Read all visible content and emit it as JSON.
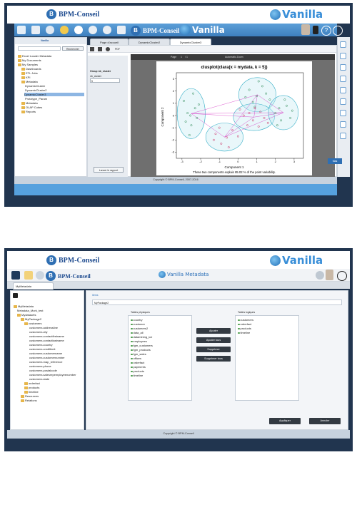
{
  "top": {
    "brand": "BPM-Conseil",
    "vanilla": "Vanilla",
    "toolbar_brand": "BPM-Conseil",
    "toolbar_vanilla": "Vanilla",
    "tree_title": "Vanilla",
    "search_button": "Rechercher",
    "tree": [
      "Excel Loader Metadata",
      "My Documents",
      "My Samples",
      "Dashboards",
      "ETL Jobs",
      "KPI",
      "Metadata",
      "DynamicCluster",
      "DynamicCluster2",
      "DynamicCluster3",
      "Prototype_Param",
      "Metadata",
      "OLAP Cubes",
      "Reports"
    ],
    "tabs": [
      "Page d'accueil",
      "DynamicCluster2",
      "DynamicCluster3"
    ],
    "viewer": {
      "pdf_label": "PDF",
      "page_label": "Page",
      "page_value": "1",
      "of_label": "/ 1",
      "zoom_label": "Automatic Zoom"
    },
    "params": {
      "group_label": "Group nb_cluster",
      "field_label": "nb_cluster",
      "field_value": "5"
    },
    "launch_button": "Lancer le rapport",
    "plot_footer": "Component 1",
    "plot_caption": "These two components explain 85.02 % of the point variability.",
    "footer": "Copyright © BPM-Conseil, 2007-2016",
    "side_button": "Mas"
  },
  "bottom": {
    "brand": "BPM-Conseil",
    "vanilla": "Vanilla",
    "toolbar_brand": "BPM-Conseil",
    "metadata_title": "Vanilla Metadata",
    "tab": "MyMetadata",
    "breadcrumb": "Items",
    "name_value": "MyPackage2",
    "tree": [
      "MyMetadata",
      "Metadata_Mork_test",
      "Mydatasets",
      "MyPackage2",
      "customers",
      "customers.addressline",
      "customers.city",
      "customers.contactfirstname",
      "customers.contactlastname",
      "customers.country",
      "customers.creditlimit",
      "customers.customername",
      "customers.customernumber",
      "customers.map_reference",
      "customers.phone",
      "customers.postalcode",
      "customers.salesrepemployeenumber",
      "customers.state",
      "orderfact",
      "products",
      "timeline",
      "Resources",
      "Relations"
    ],
    "physical_title": "Tables physiques",
    "physical_tables": [
      "country",
      "customer",
      "customers2",
      "data_all",
      "datamining_ice",
      "employees",
      "fgm_customers",
      "fgm_products",
      "fgm_sales",
      "offices",
      "orderfact",
      "payments",
      "products",
      "timeline"
    ],
    "logical_title": "Tables logiques",
    "logical_tables": [
      "customers",
      "orderfact",
      "products",
      "timeline"
    ],
    "buttons": [
      "Ajouter",
      "Ajouter tous",
      "Supprimer",
      "Supprimer tous"
    ],
    "apply_button": "Appliquer",
    "cancel_button": "Annuler",
    "footer": "Copyright © BPM-Conseil"
  },
  "chart_data": {
    "type": "scatter",
    "title": "clusplot(clara(x = mydata, k = 5))",
    "xlabel": "Component 1",
    "ylabel": "Component 2",
    "xlim": [
      -3.3,
      3.5
    ],
    "ylim": [
      -3.5,
      3.5
    ],
    "xticks": [
      -3,
      -2,
      -1,
      0,
      1,
      2,
      3
    ],
    "yticks": [
      -3,
      -2,
      -1,
      0,
      1,
      2,
      3
    ],
    "series": [
      {
        "values": [
          [
            -2.7,
            0.2
          ],
          [
            -2.5,
            -0.8
          ],
          [
            -2.9,
            1.2
          ],
          [
            -2.3,
            0.6
          ],
          [
            -2.6,
            -1.6
          ],
          [
            -2.2,
            -0.2
          ],
          [
            -2.8,
            -0.5
          ],
          [
            -2.4,
            1.8
          ],
          [
            -2.1,
            0.9
          ],
          [
            -2.55,
            0.0
          ]
        ]
      },
      {
        "values": [
          [
            -1.2,
            -1.5
          ],
          [
            -0.6,
            -1.8
          ],
          [
            -0.9,
            -2.3
          ],
          [
            -0.3,
            -1.2
          ],
          [
            -1.0,
            -1.0
          ],
          [
            -0.5,
            -2.6
          ],
          [
            -1.3,
            -2.0
          ],
          [
            0.0,
            -1.7
          ]
        ]
      },
      {
        "values": [
          [
            0.6,
            2.1
          ],
          [
            1.0,
            1.6
          ],
          [
            1.3,
            2.4
          ],
          [
            0.8,
            1.1
          ],
          [
            1.5,
            1.8
          ],
          [
            0.4,
            1.5
          ],
          [
            1.1,
            2.8
          ],
          [
            1.7,
            1.3
          ],
          [
            0.9,
            0.7
          ]
        ]
      },
      {
        "values": [
          [
            0.3,
            0.0
          ],
          [
            0.8,
            -0.4
          ],
          [
            1.2,
            0.3
          ],
          [
            0.5,
            -0.8
          ],
          [
            1.4,
            -0.2
          ],
          [
            0.1,
            0.5
          ],
          [
            0.9,
            0.6
          ],
          [
            1.6,
            -0.6
          ],
          [
            0.6,
            0.2
          ],
          [
            1.1,
            -0.9
          ]
        ]
      },
      {
        "values": [
          [
            2.0,
            0.2
          ],
          [
            2.3,
            -0.4
          ],
          [
            2.6,
            0.8
          ],
          [
            2.2,
            0.6
          ],
          [
            2.8,
            -0.2
          ],
          [
            2.5,
            1.3
          ],
          [
            2.1,
            -0.8
          ],
          [
            2.9,
            0.4
          ]
        ]
      }
    ]
  }
}
